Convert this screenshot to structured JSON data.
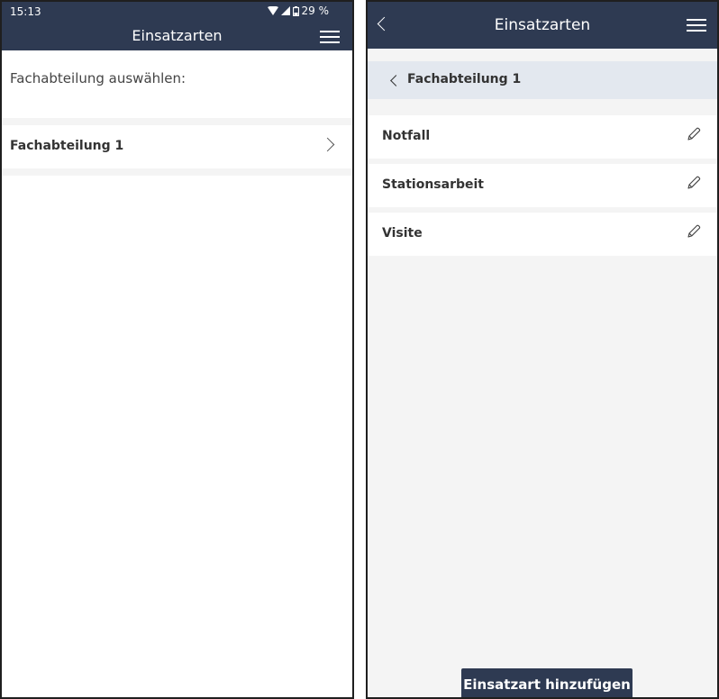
{
  "left_screen": {
    "status": {
      "time": "15:13",
      "battery": "29 %",
      "wifi_icon": "wifi-icon",
      "signal_icon": "signal-icon",
      "battery_icon": "battery-icon"
    },
    "title": "Einsatzarten",
    "prompt": "Fachabteilung auswählen:",
    "departments": [
      {
        "label": "Fachabteilung 1"
      }
    ]
  },
  "right_screen": {
    "title": "Einsatzarten",
    "breadcrumb": "Fachabteilung 1",
    "items": [
      {
        "label": "Notfall"
      },
      {
        "label": "Stationsarbeit"
      },
      {
        "label": "Visite"
      }
    ],
    "add_button": "Einsatzart hinzufügen"
  },
  "colors": {
    "header": "#2e3a52",
    "breadcrumb_bg": "#e3e8ef",
    "background": "#f4f4f4"
  }
}
